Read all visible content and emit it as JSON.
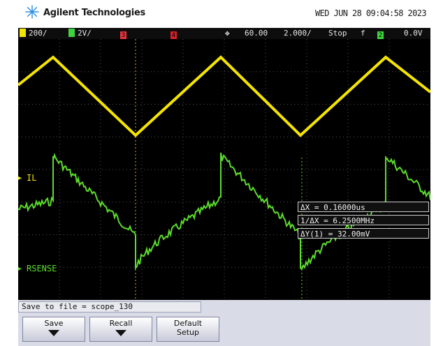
{
  "brand": {
    "name": "Agilent Technologies",
    "datetime": "WED JUN 28 09:04:58 2023"
  },
  "status": {
    "ch1_scale": "200/",
    "ch2_scale": "2V/",
    "ch3_num": "3",
    "ch4_num": "4",
    "h_position": "60.00",
    "timebase": "2.000/",
    "acq_mode": "Stop",
    "trigger_source": "2",
    "trigger_level": "0.0V",
    "colors": {
      "ch1": "#f2e600",
      "ch2": "#3fd43f",
      "ch3": "#e5343c",
      "ch4": "#d81f26"
    }
  },
  "traces": {
    "ch1_label": "IL",
    "ch2_label": "RSENSE",
    "ch1_color": "#f4e400",
    "ch2_color": "#5cdc2c"
  },
  "cursors": {
    "dx": "ΔX = 0.16000us",
    "inv_dx": "1/ΔX = 6.2500MHz",
    "dy": "ΔY(1) = 32.00mV"
  },
  "softkeys": {
    "save_to_file_label": "Save to file =",
    "save_to_file_value": "scope_130",
    "save": "Save",
    "recall": "Recall",
    "default_setup_line1": "Default",
    "default_setup_line2": "Setup"
  }
}
